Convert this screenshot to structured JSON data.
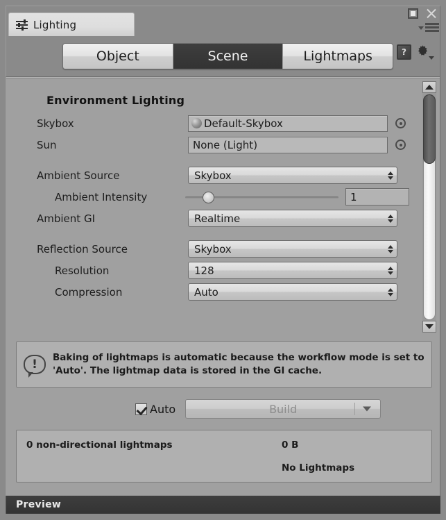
{
  "window": {
    "tab_title": "Lighting",
    "tab_icon": "sliders-icon",
    "maximize_icon": "maximize-icon",
    "close_icon": "close-icon",
    "menu_icon": "hamburger-menu-icon",
    "menu_caret_icon": "caret-down-icon"
  },
  "toolbar": {
    "tabs": [
      {
        "label": "Object",
        "active": false
      },
      {
        "label": "Scene",
        "active": true
      },
      {
        "label": "Lightmaps",
        "active": false
      }
    ],
    "help_icon": "help-book-icon",
    "help_glyph": "?",
    "settings_icon": "gear-icon"
  },
  "environment": {
    "section_title": "Environment Lighting",
    "rows": [
      {
        "label": "Skybox",
        "type": "object",
        "value": "Default-Skybox",
        "has_thumb": true
      },
      {
        "label": "Sun",
        "type": "object",
        "value": "None (Light)",
        "has_thumb": false
      },
      {
        "label": "Ambient Source",
        "type": "dropdown",
        "value": "Skybox",
        "indent": false
      },
      {
        "label": "Ambient Intensity",
        "type": "slider",
        "value": "1",
        "slider_percent": 12
      },
      {
        "label": "Ambient GI",
        "type": "dropdown",
        "value": "Realtime",
        "indent": false
      },
      {
        "label": "Reflection Source",
        "type": "dropdown",
        "value": "Skybox",
        "indent": false
      },
      {
        "label": "Resolution",
        "type": "dropdown",
        "value": "128",
        "indent": true
      },
      {
        "label": "Compression",
        "type": "dropdown",
        "value": "Auto",
        "indent": true
      }
    ]
  },
  "scrollbar": {
    "up_arrow_icon": "triangle-up-icon",
    "down_arrow_icon": "triangle-down-icon",
    "thumb_position_percent": 0,
    "thumb_size_percent": 30
  },
  "info": {
    "icon": "info-bubble-icon",
    "glyph": "!",
    "message": "Baking of lightmaps is automatic because the workflow mode is set to 'Auto'. The lightmap data is stored in the GI cache."
  },
  "build": {
    "auto_label": "Auto",
    "auto_checked": true,
    "build_label": "Build",
    "build_caret_icon": "caret-down-icon"
  },
  "stats": {
    "count_text": "0 non-directional lightmaps",
    "size_text": "0 B",
    "status_text": "No Lightmaps"
  },
  "preview": {
    "label": "Preview"
  }
}
